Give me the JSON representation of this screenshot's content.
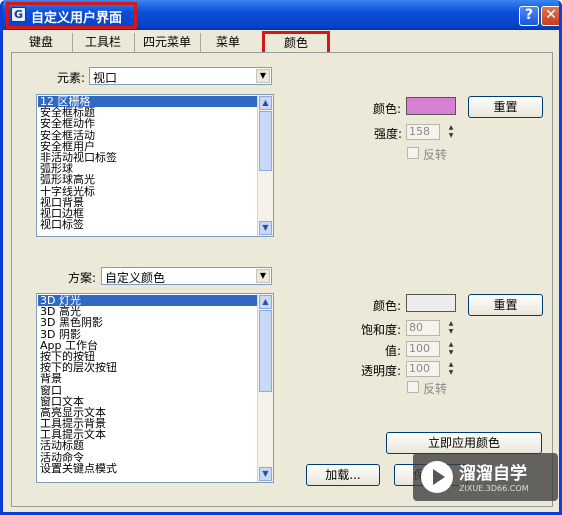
{
  "window": {
    "title": "自定义用户界面",
    "help_glyph": "?",
    "close_glyph": "✕"
  },
  "tabs": [
    "键盘",
    "工具栏",
    "四元菜单",
    "菜单",
    "颜色"
  ],
  "elements": {
    "label": "元素:",
    "value": "视口",
    "items": [
      "12 区栅格",
      "安全框标题",
      "安全框动作",
      "安全框活动",
      "安全框用户",
      "非活动视口标签",
      "弧形球",
      "弧形球高光",
      "十字线光标",
      "视口背景",
      "视口边框",
      "视口标签"
    ],
    "selected_index": 0
  },
  "elements_color": {
    "color_label": "颜色:",
    "swatch_color": "#d77fd2",
    "reset_label": "重置",
    "intensity_label": "强度:",
    "intensity_value": "158",
    "invert_label": "反转"
  },
  "scheme": {
    "label": "方案:",
    "value": "自定义颜色",
    "items": [
      "3D 灯光",
      "3D 高光",
      "3D 黑色阴影",
      "3D 阴影",
      "App 工作台",
      "按下的按钮",
      "按下的层次按钮",
      "背景",
      "窗口",
      "窗口文本",
      "高亮显示文本",
      "工具提示背景",
      "工具提示文本",
      "活动标题",
      "活动命令",
      "设置关键点模式"
    ],
    "selected_index": 0
  },
  "scheme_color": {
    "color_label": "颜色:",
    "swatch_color": "#ececec",
    "reset_label": "重置",
    "saturation_label": "饱和度:",
    "saturation_value": "80",
    "value_label": "值:",
    "value_value": "100",
    "transparency_label": "透明度:",
    "transparency_value": "100",
    "invert_label": "反转"
  },
  "buttons": {
    "apply_colors": "立即应用颜色",
    "load": "加载...",
    "save": "保存..."
  },
  "watermark": {
    "text": "溜溜自学",
    "sub": "ZIXUE.3D66.COM"
  }
}
